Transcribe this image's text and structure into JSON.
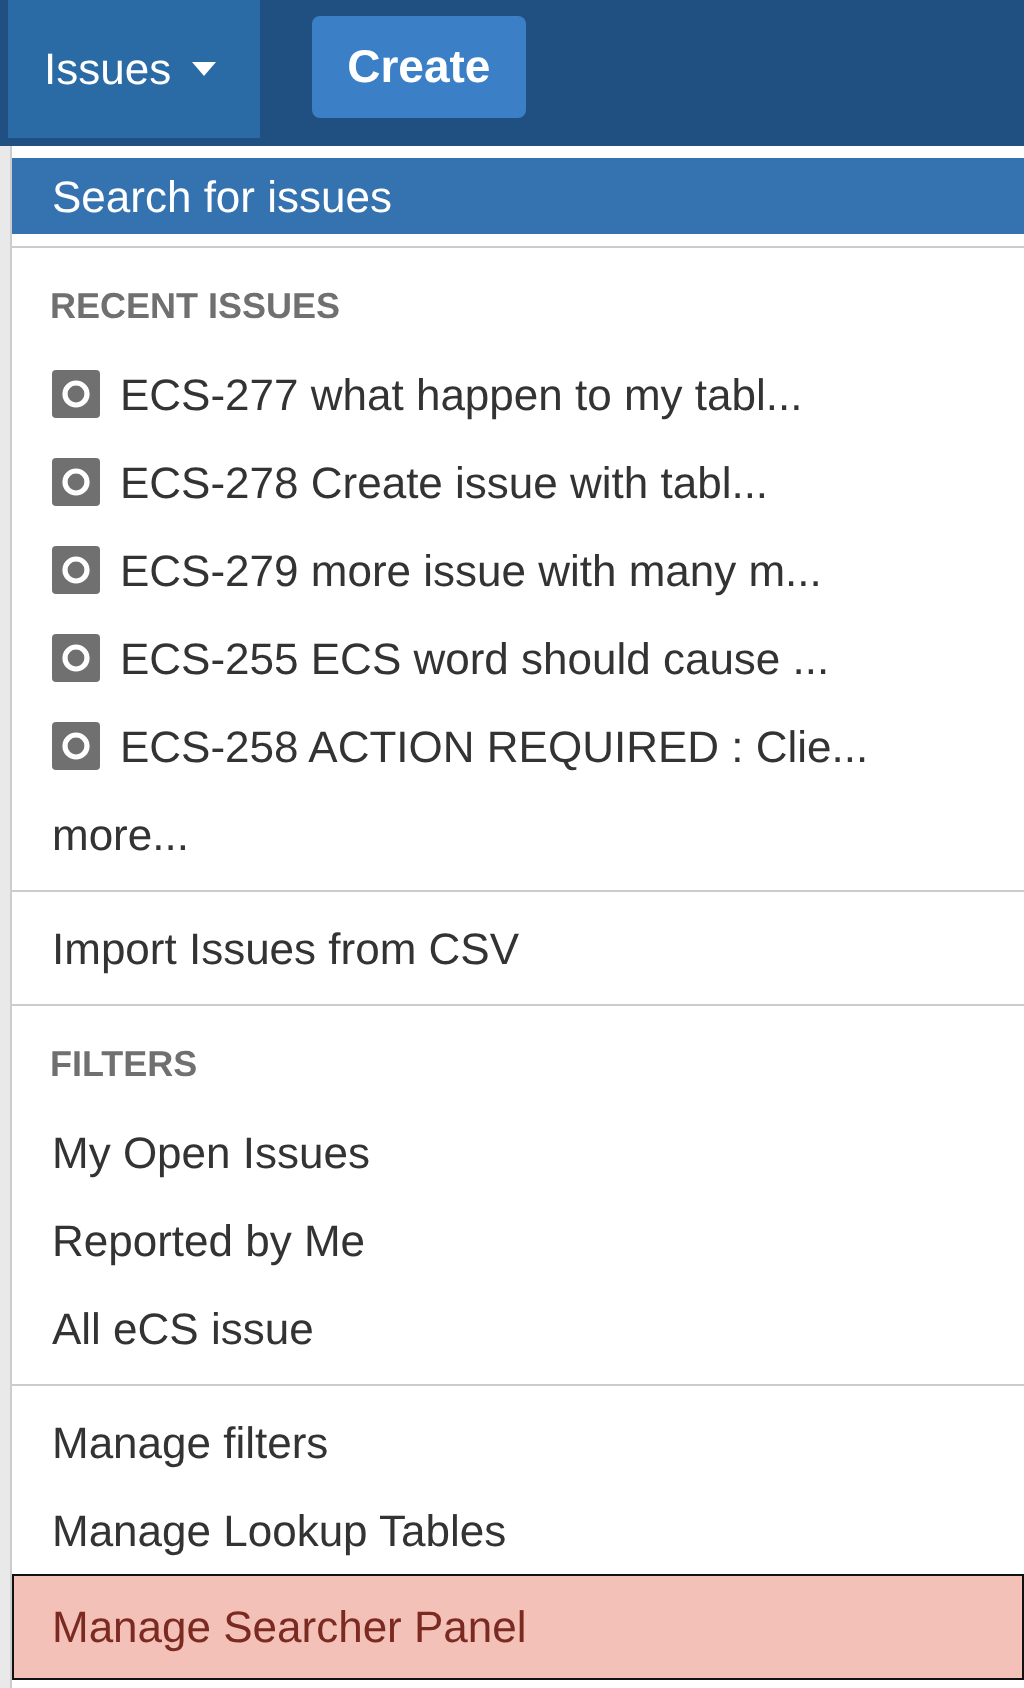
{
  "navbar": {
    "tabs": [
      {
        "label": "Issues",
        "selected": true
      }
    ],
    "create_button": "Create"
  },
  "menu": {
    "sections": [
      {
        "items": [
          {
            "kind": "link",
            "label": "Search for issues",
            "selected": true,
            "flagged": false
          }
        ]
      },
      {
        "heading": "RECENT ISSUES",
        "items": [
          {
            "kind": "issue",
            "label": "ECS-277 what happen to my tabl...",
            "selected": false,
            "flagged": false
          },
          {
            "kind": "issue",
            "label": "ECS-278 Create issue with tabl...",
            "selected": false,
            "flagged": false
          },
          {
            "kind": "issue",
            "label": "ECS-279 more issue with many m...",
            "selected": false,
            "flagged": false
          },
          {
            "kind": "issue",
            "label": "ECS-255 ECS word should cause ...",
            "selected": false,
            "flagged": false
          },
          {
            "kind": "issue",
            "label": "ECS-258 ACTION REQUIRED : Clie...",
            "selected": false,
            "flagged": false
          },
          {
            "kind": "link",
            "label": "more...",
            "selected": false,
            "flagged": false
          }
        ]
      },
      {
        "items": [
          {
            "kind": "link",
            "label": "Import Issues from CSV",
            "selected": false,
            "flagged": false
          }
        ]
      },
      {
        "heading": "FILTERS",
        "items": [
          {
            "kind": "link",
            "label": "My Open Issues",
            "selected": false,
            "flagged": false
          },
          {
            "kind": "link",
            "label": "Reported by Me",
            "selected": false,
            "flagged": false
          },
          {
            "kind": "link",
            "label": "All eCS issue",
            "selected": false,
            "flagged": false
          }
        ]
      },
      {
        "items": [
          {
            "kind": "link",
            "label": "Manage filters",
            "selected": false,
            "flagged": false
          },
          {
            "kind": "link",
            "label": "Manage Lookup Tables",
            "selected": false,
            "flagged": false
          },
          {
            "kind": "link",
            "label": "Manage Searcher Panel",
            "selected": false,
            "flagged": true
          }
        ]
      }
    ]
  }
}
